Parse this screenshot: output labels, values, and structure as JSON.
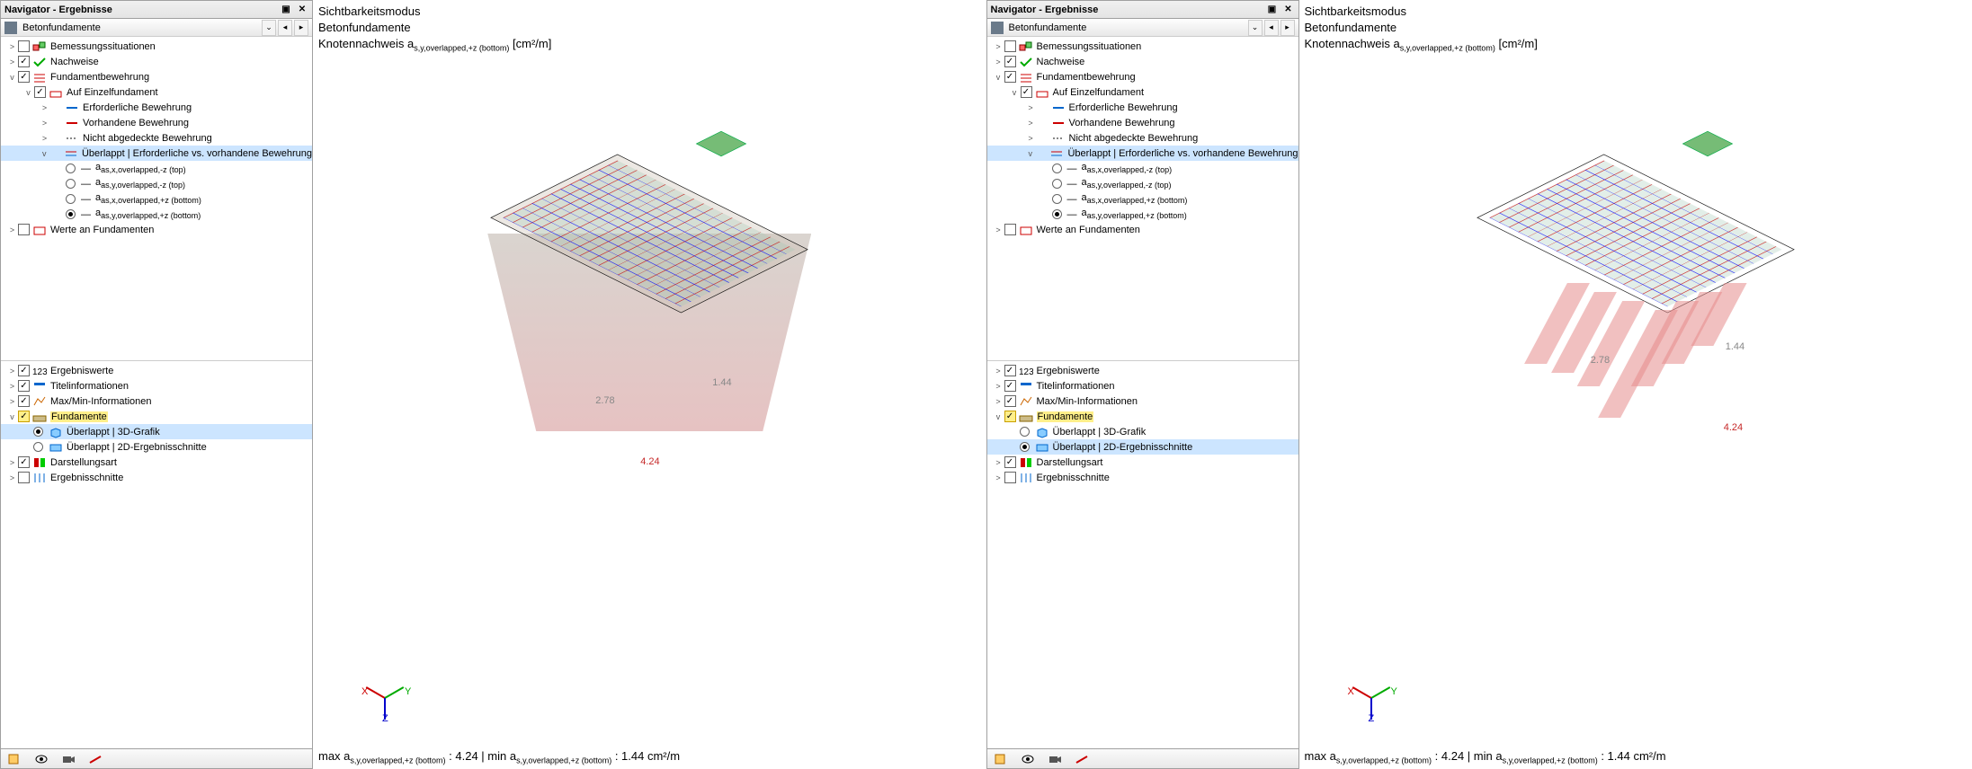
{
  "nav_title": "Navigator - Ergebnisse",
  "combo_label": "Betonfundamente",
  "tree_top": [
    {
      "label": "Bemessungssituationen",
      "checked": false,
      "expand": ">",
      "icon": "situations"
    },
    {
      "label": "Nachweise",
      "checked": true,
      "expand": ">",
      "icon": "checks"
    },
    {
      "label": "Fundamentbewehrung",
      "checked": true,
      "expand": "v",
      "icon": "rebar"
    }
  ],
  "tree_auf": {
    "label": "Auf Einzelfundament",
    "checked": true,
    "expand": "v"
  },
  "tree_auf_children": [
    {
      "label": "Erforderliche Bewehrung",
      "expand": ">"
    },
    {
      "label": "Vorhandene Bewehrung",
      "expand": ">"
    },
    {
      "label": "Nicht abgedeckte Bewehrung",
      "expand": ">"
    }
  ],
  "tree_over": {
    "label": "Überlappt | Erforderliche vs. vorhandene Bewehrung",
    "expand": "v",
    "selected": true
  },
  "radios": [
    {
      "label": "as,x,overlapped,-z (top)",
      "ck": false
    },
    {
      "label": "as,y,overlapped,-z (top)",
      "ck": false
    },
    {
      "label": "as,x,overlapped,+z (bottom)",
      "ck": false
    },
    {
      "label": "as,y,overlapped,+z (bottom)",
      "ck": true
    }
  ],
  "tree_werte": {
    "label": "Werte an Fundamenten",
    "checked": false,
    "expand": ">"
  },
  "tree_bottom": [
    {
      "label": "Ergebniswerte",
      "checked": true,
      "expand": ">",
      "icon": "values"
    },
    {
      "label": "Titelinformationen",
      "checked": true,
      "expand": ">",
      "icon": "title"
    },
    {
      "label": "Max/Min-Informationen",
      "checked": true,
      "expand": ">",
      "icon": "maxmin"
    }
  ],
  "tree_fund": {
    "label": "Fundamente",
    "checked": true,
    "expand": "v",
    "hl": true
  },
  "fund_radios": [
    {
      "label": "Überlappt | 3D-Grafik",
      "icon": "3d"
    },
    {
      "label": "Überlappt | 2D-Ergebnisschnitte",
      "icon": "2d"
    }
  ],
  "tree_bottom2": [
    {
      "label": "Darstellungsart",
      "checked": true,
      "expand": ">",
      "icon": "display"
    },
    {
      "label": "Ergebnisschnitte",
      "checked": false,
      "expand": ">",
      "icon": "sections"
    }
  ],
  "view": {
    "l1": "Sichtbarkeitsmodus",
    "l2": "Betonfundamente",
    "l3_pre": "Knotennachweis a",
    "l3_sub": "s,y,overlapped,+z (bottom)",
    "l3_unit": " [cm²/m]",
    "v1": "2.78",
    "v2": "1.44",
    "v3": "4.24",
    "bot_pre": "max a",
    "bot_sub": "s,y,overlapped,+z (bottom)",
    "bot_mid": " : 4.24 | min a",
    "bot_post": " : 1.44 cm²/m"
  },
  "left": {
    "fund_radio_sel": 0
  },
  "right": {
    "fund_radio_sel": 1
  }
}
